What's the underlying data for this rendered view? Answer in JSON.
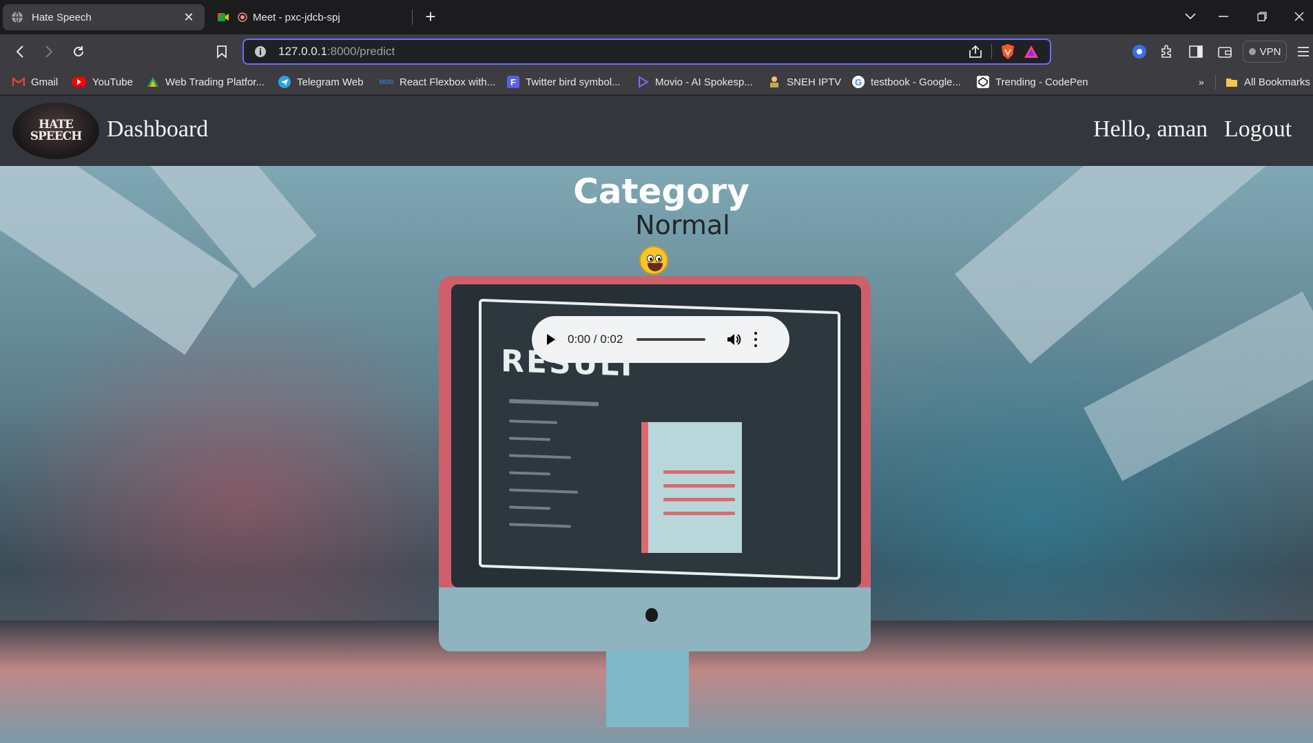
{
  "browser": {
    "tabs": [
      {
        "title": "Hate Speech",
        "active": true
      },
      {
        "title": "Meet - pxc-jdcb-spj",
        "active": false
      }
    ],
    "url": {
      "host": "127.0.0.1",
      "path": ":8000/predict"
    },
    "vpn_label": "VPN",
    "bookmarks": [
      {
        "label": "Gmail",
        "icon": "gmail-icon"
      },
      {
        "label": "YouTube",
        "icon": "youtube-icon"
      },
      {
        "label": "Web Trading Platfor...",
        "icon": "trading-icon"
      },
      {
        "label": "Telegram Web",
        "icon": "telegram-icon"
      },
      {
        "label": "React Flexbox with...",
        "icon": "mdb-icon"
      },
      {
        "label": "Twitter bird symbol...",
        "icon": "f-icon"
      },
      {
        "label": "Movio - AI Spokesp...",
        "icon": "movio-icon"
      },
      {
        "label": "SNEH IPTV",
        "icon": "iptv-icon"
      },
      {
        "label": "testbook - Google...",
        "icon": "google-icon"
      },
      {
        "label": "Trending - CodePen",
        "icon": "codepen-icon"
      }
    ],
    "overflow_label": "»",
    "all_bookmarks_label": "All Bookmarks"
  },
  "navbar": {
    "logo_text": "HATE SPEECH",
    "brand": "Dashboard",
    "greeting": "Hello, aman",
    "logout": "Logout"
  },
  "result": {
    "heading": "Category",
    "label": "Normal",
    "emoji": "grinning-face-icon"
  },
  "audio": {
    "time": "0:00 / 0:02",
    "progress": 0
  },
  "hero_screen_text": "RESULT",
  "colors": {
    "accent": "#6e6ef5",
    "navbar_bg": "#33363c",
    "monitor": "#cf5f6a"
  }
}
